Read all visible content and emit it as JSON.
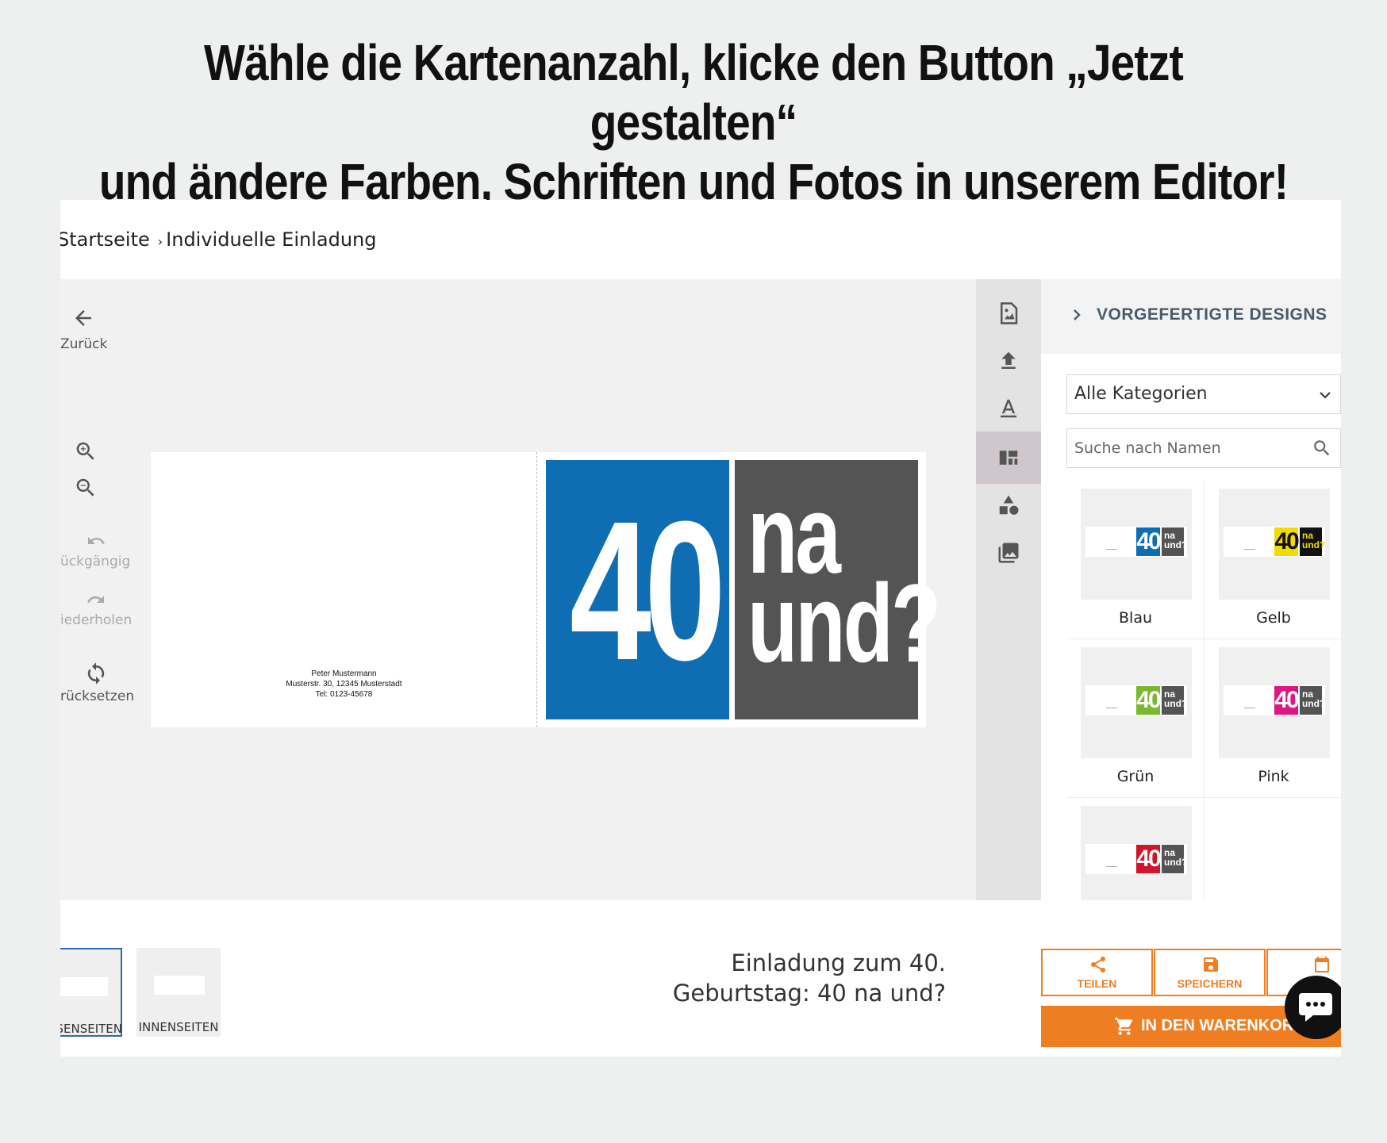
{
  "headline": {
    "line1": "Wähle die Kartenanzahl, klicke den Button „Jetzt gestalten“",
    "line2": "und ändere Farben, Schriften und Fotos in unserem Editor!"
  },
  "breadcrumb": {
    "home": "Startseite",
    "current": "Individuelle Einladung"
  },
  "tools": {
    "back": "Zurück",
    "undo": "ückgängig",
    "redo": "iederholen",
    "reset": "rücksetzen"
  },
  "card": {
    "address": [
      "Peter Mustermann",
      "Musterstr. 30, 12345 Musterstadt",
      "Tel: 0123-45678"
    ],
    "number": "40",
    "text1": "na",
    "text2": "und?",
    "colors": {
      "blue": "#0f6db4",
      "gray": "#545454"
    }
  },
  "panel": {
    "title": "VORGEFERTIGTE DESIGNS",
    "category": "Alle Kategorien",
    "search_placeholder": "Suche nach Namen",
    "designs": [
      {
        "label": "Blau",
        "color": "#0f6db4",
        "num": "40",
        "t1": "na",
        "t2": "und?"
      },
      {
        "label": "Gelb",
        "color": "#f2dc00",
        "num": "40",
        "t1": "na",
        "t2": "und?"
      },
      {
        "label": "Grün",
        "color": "#7cb82f",
        "num": "40",
        "t1": "na",
        "t2": "und?"
      },
      {
        "label": "Pink",
        "color": "#e0157f",
        "num": "40",
        "t1": "na",
        "t2": "und?"
      },
      {
        "label": "",
        "color": "#d0152a",
        "num": "40",
        "t1": "na",
        "t2": "und?"
      }
    ]
  },
  "pages": {
    "outer": "SSENSEITEN",
    "inner": "INNENSEITEN"
  },
  "product": {
    "title_line1": "Einladung zum 40.",
    "title_line2": "Geburtstag: 40 na und?"
  },
  "actions": {
    "share": "TEILEN",
    "save": "SPEICHERN",
    "cart": "IN DEN WARENKORB"
  },
  "accent_color": "#ef7d22"
}
